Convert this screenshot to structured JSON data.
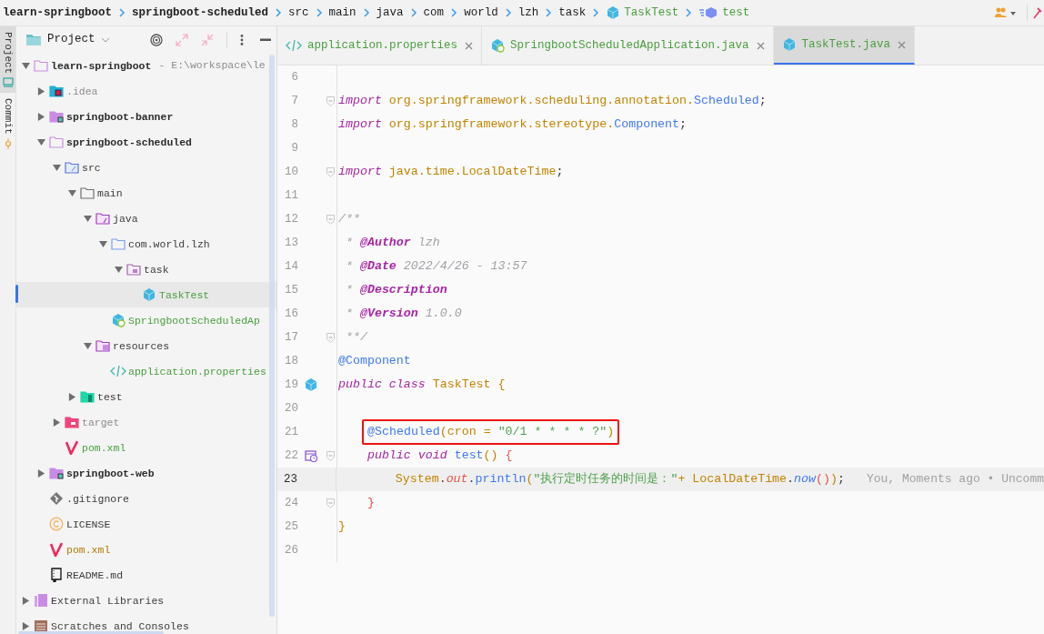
{
  "breadcrumbs": [
    {
      "kind": "project",
      "label": "learn-springboot"
    },
    {
      "kind": "project",
      "label": "springboot-scheduled"
    },
    {
      "kind": "folder",
      "label": "src"
    },
    {
      "kind": "folder",
      "label": "main"
    },
    {
      "kind": "folder",
      "label": "java"
    },
    {
      "kind": "folder",
      "label": "com"
    },
    {
      "kind": "folder",
      "label": "world"
    },
    {
      "kind": "folder",
      "label": "lzh"
    },
    {
      "kind": "folder",
      "label": "task"
    },
    {
      "kind": "class",
      "label": "TaskTest"
    },
    {
      "kind": "method",
      "label": "test"
    }
  ],
  "side_strip": [
    {
      "label": "Project",
      "selected": true
    },
    {
      "label": "Commit",
      "selected": false
    }
  ],
  "project_panel": {
    "title": "Project",
    "tree": [
      {
        "label": "learn-springboot",
        "suffix": "- E:\\workspace\\le",
        "kind": "module-folder",
        "expanded": true,
        "selected": false,
        "children": [
          {
            "label": ".idea",
            "kind": "idea",
            "color": "#8c8c8c",
            "expanded": false,
            "selected": false
          },
          {
            "label": "springboot-banner",
            "kind": "module",
            "expanded": false,
            "selected": false
          },
          {
            "label": "springboot-scheduled",
            "kind": "module-folder",
            "expanded": true,
            "selected": false,
            "children": [
              {
                "label": "src",
                "kind": "src",
                "expanded": true,
                "selected": false,
                "children": [
                  {
                    "label": "main",
                    "kind": "folder",
                    "expanded": true,
                    "selected": false,
                    "children": [
                      {
                        "label": "java",
                        "kind": "java-root",
                        "expanded": true,
                        "selected": false,
                        "children": [
                          {
                            "label": "com.world.lzh",
                            "kind": "package",
                            "expanded": true,
                            "selected": false,
                            "children": [
                              {
                                "label": "task",
                                "kind": "task-package",
                                "expanded": true,
                                "selected": false,
                                "children": [
                                  {
                                    "label": "TaskTest",
                                    "kind": "class",
                                    "color": "#4a9e3f",
                                    "selected": true
                                  }
                                ]
                              }
                            ]
                          },
                          {
                            "label": "SpringbootScheduledAp",
                            "kind": "spring-class",
                            "color": "#4a9e3f",
                            "selected": false
                          }
                        ]
                      },
                      {
                        "label": "resources",
                        "kind": "resources",
                        "expanded": true,
                        "selected": false,
                        "children": [
                          {
                            "label": "application.properties",
                            "kind": "properties",
                            "color": "#4a9e3f",
                            "selected": false
                          }
                        ]
                      }
                    ]
                  },
                  {
                    "label": "test",
                    "kind": "test-folder",
                    "expanded": false,
                    "selected": false
                  }
                ]
              },
              {
                "label": "target",
                "kind": "target",
                "color": "#8c8c8c",
                "expanded": false,
                "selected": false
              },
              {
                "label": "pom.xml",
                "kind": "maven",
                "color": "#4a9e3f",
                "selected": false
              }
            ]
          },
          {
            "label": "springboot-web",
            "kind": "module",
            "expanded": false,
            "selected": false
          },
          {
            "label": ".gitignore",
            "kind": "git",
            "selected": false
          },
          {
            "label": "LICENSE",
            "kind": "license",
            "selected": false
          },
          {
            "label": "pom.xml",
            "kind": "maven",
            "color": "#b07a00",
            "selected": false
          },
          {
            "label": "README.md",
            "kind": "readme",
            "selected": false
          }
        ]
      },
      {
        "label": "External Libraries",
        "kind": "libraries",
        "expanded": false,
        "selected": false
      },
      {
        "label": "Scratches and Consoles",
        "kind": "scratches",
        "expanded": false,
        "selected": false
      }
    ]
  },
  "editor_tabs": [
    {
      "label": "application.properties",
      "kind": "properties",
      "selected": false
    },
    {
      "label": "SpringbootScheduledApplication.java",
      "kind": "spring-class",
      "selected": false
    },
    {
      "label": "TaskTest.java",
      "kind": "class",
      "selected": true
    }
  ],
  "code_lines": [
    {
      "number": "6"
    },
    {
      "number": "7",
      "fold": true,
      "tokens": [
        {
          "kind": "keyword",
          "text": "import"
        },
        {
          "kind": "pkg",
          "text": " org.springframework.scheduling.annotation."
        },
        {
          "kind": "type",
          "text": "Scheduled"
        },
        {
          "kind": "plain",
          "text": ";"
        }
      ]
    },
    {
      "number": "8",
      "tokens": [
        {
          "kind": "keyword",
          "text": "import"
        },
        {
          "kind": "pkg",
          "text": " org.springframework.stereotype."
        },
        {
          "kind": "type",
          "text": "Component"
        },
        {
          "kind": "plain",
          "text": ";"
        }
      ]
    },
    {
      "number": "9"
    },
    {
      "number": "10",
      "fold": true,
      "tokens": [
        {
          "kind": "keyword",
          "text": "import"
        },
        {
          "kind": "pkg",
          "text": " java.time.LocalDateTime"
        },
        {
          "kind": "plain",
          "text": ";"
        }
      ]
    },
    {
      "number": "11"
    },
    {
      "number": "12",
      "fold": true,
      "tokens": [
        {
          "kind": "comment",
          "text": "/**"
        }
      ]
    },
    {
      "number": "13",
      "tokens": [
        {
          "kind": "comment",
          "text": " * "
        },
        {
          "kind": "doctag",
          "text": "@Author"
        },
        {
          "kind": "comment",
          "text": " lzh"
        }
      ]
    },
    {
      "number": "14",
      "tokens": [
        {
          "kind": "comment",
          "text": " * "
        },
        {
          "kind": "doctag",
          "text": "@Date"
        },
        {
          "kind": "comment",
          "text": " 2022/4/26 - 13:57"
        }
      ]
    },
    {
      "number": "15",
      "tokens": [
        {
          "kind": "comment",
          "text": " * "
        },
        {
          "kind": "doctag",
          "text": "@Description"
        }
      ]
    },
    {
      "number": "16",
      "tokens": [
        {
          "kind": "comment",
          "text": " * "
        },
        {
          "kind": "doctag",
          "text": "@Version"
        },
        {
          "kind": "comment",
          "text": " 1.0.0"
        }
      ]
    },
    {
      "number": "17",
      "fold": true,
      "tokens": [
        {
          "kind": "comment",
          "text": " **/"
        }
      ]
    },
    {
      "number": "18",
      "tokens": [
        {
          "kind": "type",
          "text": "@Component"
        }
      ]
    },
    {
      "number": "19",
      "gutter": {
        "kind": "class"
      },
      "tokens": [
        {
          "kind": "keyword",
          "text": "public class "
        },
        {
          "kind": "pkg",
          "text": "TaskTest {"
        }
      ]
    },
    {
      "number": "20"
    },
    {
      "number": "21",
      "boxed": true,
      "tokens": [
        {
          "kind": "type",
          "text": "@Scheduled"
        },
        {
          "kind": "pkg",
          "text": "(cron = "
        },
        {
          "kind": "string",
          "text": "\"0/1 * * * * ?\""
        },
        {
          "kind": "pkg",
          "text": ")"
        }
      ]
    },
    {
      "number": "22",
      "gutter": {
        "kind": "scheduled"
      },
      "fold": true,
      "tokens": [
        {
          "kind": "keyword",
          "text": "    public void "
        },
        {
          "kind": "method",
          "text": "test"
        },
        {
          "kind": "pkg",
          "text": "() "
        },
        {
          "kind": "brace",
          "text": "{"
        }
      ]
    },
    {
      "number": "23",
      "current": true,
      "blame": "You, Moments ago • Uncomm",
      "tokens": [
        {
          "kind": "pkg",
          "text": "        System"
        },
        {
          "kind": "plain",
          "text": "."
        },
        {
          "kind": "field",
          "text": "out"
        },
        {
          "kind": "plain",
          "text": "."
        },
        {
          "kind": "method",
          "text": "println"
        },
        {
          "kind": "pkg",
          "text": "("
        },
        {
          "kind": "string",
          "text": "\"执行定时任务的时间是：\""
        },
        {
          "kind": "pkg",
          "text": "+ LocalDateTime"
        },
        {
          "kind": "plain",
          "text": "."
        },
        {
          "kind": "static",
          "text": "now"
        },
        {
          "kind": "brace",
          "text": "()"
        },
        {
          "kind": "pkg",
          "text": ")"
        },
        {
          "kind": "plain",
          "text": ";"
        }
      ]
    },
    {
      "number": "24",
      "fold": true,
      "tokens": [
        {
          "kind": "brace",
          "text": "    }"
        }
      ]
    },
    {
      "number": "25",
      "tokens": [
        {
          "kind": "pkg",
          "text": "}"
        }
      ]
    },
    {
      "number": "26"
    }
  ]
}
